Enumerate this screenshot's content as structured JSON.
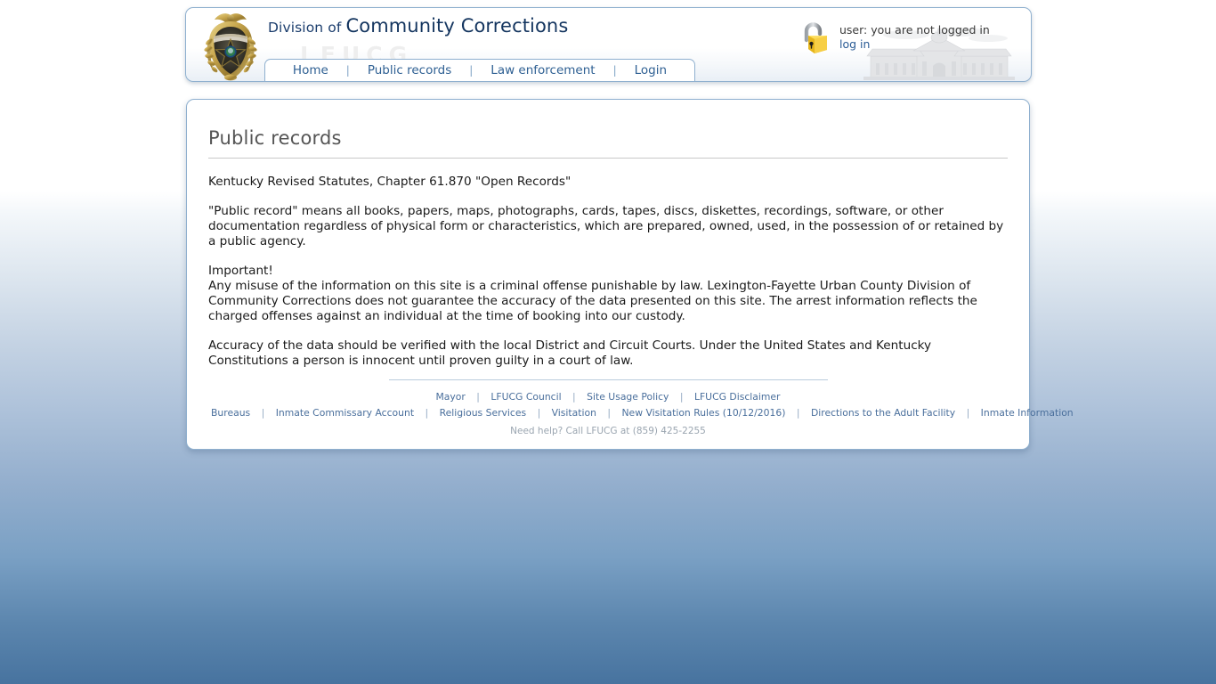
{
  "header": {
    "badge_icon": "police-badge-emblem",
    "division_prefix": "Division of",
    "division_name": "Community Corrections",
    "watermark": "LFUCG",
    "building_watermark_icon": "government-building-watermark",
    "lock_icon": "open-padlock-icon",
    "user_status": "user: you are not logged in",
    "login_label": "log in",
    "separator": "|",
    "nav": [
      {
        "label": "Home"
      },
      {
        "label": "Public records"
      },
      {
        "label": "Law enforcement"
      },
      {
        "label": "Login"
      }
    ]
  },
  "main": {
    "title": "Public records",
    "statute_line": "Kentucky Revised Statutes, Chapter 61.870 \"Open Records\"",
    "definition": "\"Public record\" means all books, papers, maps, photographs, cards, tapes, discs, diskettes, recordings, software, or other documentation regardless of physical form or characteristics, which are prepared, owned, used, in the possession of or retained by a public agency.",
    "important_label": "Important!",
    "important_text": "Any misuse of the information on this site is a criminal offense punishable by law. Lexington-Fayette Urban County Division of Community Corrections does not guarantee the accuracy of the data presented on this site. The arrest information reflects the charged offenses against an individual at the time of booking into our custody.",
    "accuracy_text": "Accuracy of the data should be verified with the local District and Circuit Courts. Under the United States and Kentucky Constitutions a person is innocent until proven guilty in a court of law."
  },
  "footer": {
    "separator": "|",
    "row1": [
      {
        "label": "Mayor"
      },
      {
        "label": "LFUCG Council"
      },
      {
        "label": "Site Usage Policy"
      },
      {
        "label": "LFUCG Disclaimer"
      }
    ],
    "row2": [
      {
        "label": "Bureaus"
      },
      {
        "label": "Inmate Commissary Account"
      },
      {
        "label": "Religious Services"
      },
      {
        "label": "Visitation"
      },
      {
        "label": "New Visitation Rules (10/12/2016)"
      },
      {
        "label": "Directions to the Adult Facility"
      },
      {
        "label": "Inmate Information"
      }
    ],
    "help_text": "Need help? Call LFUCG at (859) 425-2255"
  },
  "colors": {
    "brand_navy": "#14355f",
    "link_blue": "#2f6093",
    "footer_link": "#4a6f9c",
    "page_bottom": "#47739f",
    "card_border": "#8fb0cf"
  }
}
